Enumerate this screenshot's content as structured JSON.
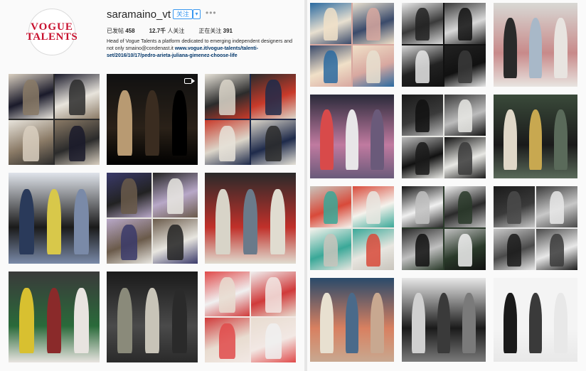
{
  "profile": {
    "logo_line1": "VOGUE",
    "logo_line2": "TALENTS",
    "username": "saramaino_vt",
    "follow_label": "关注",
    "dropdown_label": "▾",
    "more_label": "•••",
    "stats": {
      "posts_label": "已发帖",
      "posts_value": "458",
      "followers_value": "12.7千",
      "followers_label": "人关注",
      "following_label": "正在关注",
      "following_value": "391"
    },
    "bio_text": "Head of Vogue Talents a platform dedicated to emerging independent designers and not only smaino@condenast.it ",
    "bio_link": "www.vogue.it/vogue-talents/talenti-set/2016/10/17/pedro-arieta-juliana-gimenez-choose-life"
  },
  "colors": {
    "accent": "#3897f0",
    "logo_red": "#c8102e",
    "link": "#003569"
  },
  "left_grid": {
    "posts": [
      {
        "name": "post-1",
        "type": "collage-clothing"
      },
      {
        "name": "post-2",
        "type": "runway-video",
        "video": true
      },
      {
        "name": "post-3",
        "type": "collage-clothing"
      },
      {
        "name": "post-4",
        "type": "runway"
      },
      {
        "name": "post-5",
        "type": "collage-runway"
      },
      {
        "name": "post-6",
        "type": "runway"
      },
      {
        "name": "post-7",
        "type": "garments"
      },
      {
        "name": "post-8",
        "type": "runway"
      },
      {
        "name": "post-9",
        "type": "collage-clothing"
      }
    ]
  },
  "right_grid": {
    "posts": [
      {
        "name": "post-10",
        "type": "collage"
      },
      {
        "name": "post-11",
        "type": "collage-clothing"
      },
      {
        "name": "post-12",
        "type": "mannequins"
      },
      {
        "name": "post-13",
        "type": "runway"
      },
      {
        "name": "post-14",
        "type": "collage-clothing"
      },
      {
        "name": "post-15",
        "type": "showroom"
      },
      {
        "name": "post-16",
        "type": "collage-bags"
      },
      {
        "name": "post-17",
        "type": "collage-clothing"
      },
      {
        "name": "post-18",
        "type": "collage-clothing"
      },
      {
        "name": "post-19",
        "type": "runway"
      },
      {
        "name": "post-20",
        "type": "runway"
      },
      {
        "name": "post-21",
        "type": "portrait"
      }
    ]
  }
}
